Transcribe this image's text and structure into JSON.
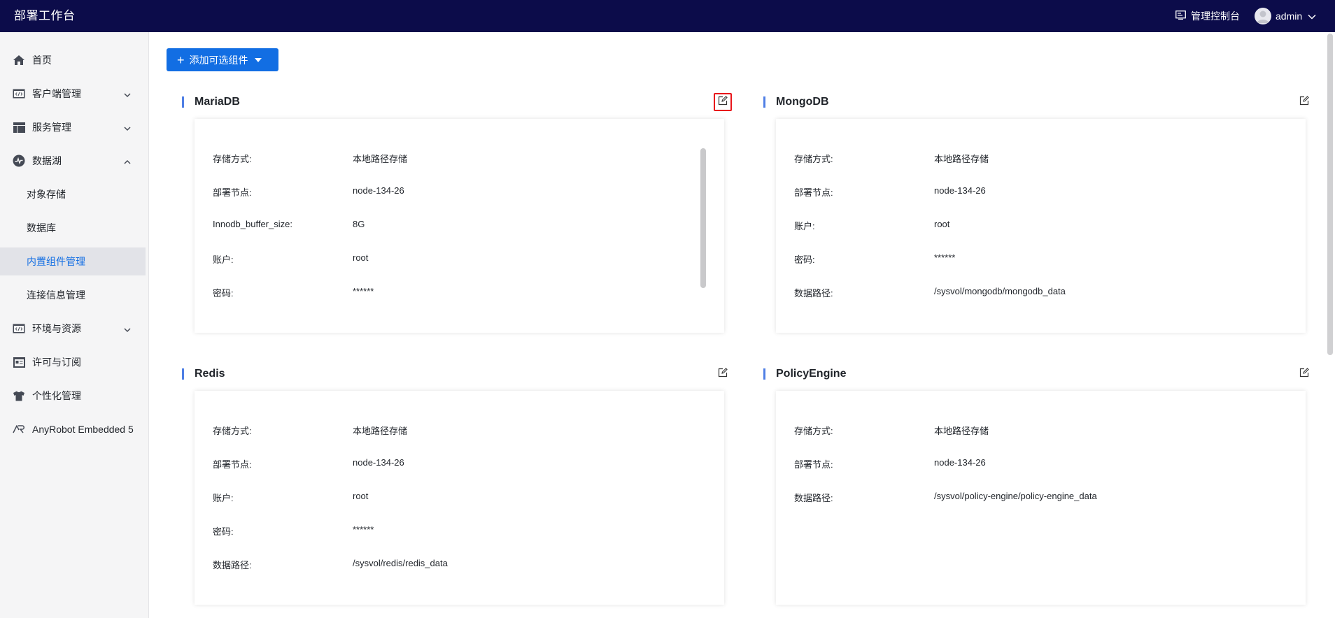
{
  "app": {
    "title": "部署工作台"
  },
  "topbar": {
    "console_label": "管理控制台",
    "user_name": "admin",
    "console_icon": "monitor-icon",
    "user_icon": "user-avatar-icon"
  },
  "sidebar": {
    "items": [
      {
        "label": "首页",
        "icon": "home-icon"
      },
      {
        "label": "客户端管理",
        "icon": "code-window-icon",
        "expandable": true,
        "expanded": false
      },
      {
        "label": "服务管理",
        "icon": "layout-icon",
        "expandable": true,
        "expanded": false
      },
      {
        "label": "数据湖",
        "icon": "pulse-icon",
        "expandable": true,
        "expanded": true
      },
      {
        "label": "环境与资源",
        "icon": "code-window-icon",
        "expandable": true,
        "expanded": false
      },
      {
        "label": "许可与订阅",
        "icon": "license-icon"
      },
      {
        "label": "个性化管理",
        "icon": "shirt-icon"
      },
      {
        "label": "AnyRobot Embedded 5",
        "icon": "anyrobot-icon"
      }
    ],
    "subitems": [
      {
        "label": "对象存储",
        "active": false
      },
      {
        "label": "数据库",
        "active": false
      },
      {
        "label": "内置组件管理",
        "active": true
      },
      {
        "label": "连接信息管理",
        "active": false
      }
    ]
  },
  "toolbar": {
    "add_label": "添加可选组件"
  },
  "components": [
    {
      "title": "MariaDB",
      "highlighted": true,
      "rows": [
        {
          "key": "存储方式:",
          "value": "本地路径存储"
        },
        {
          "key": "部署节点:",
          "value": "node-134-26"
        },
        {
          "key": "Innodb_buffer_size:",
          "value": "8G"
        },
        {
          "key": "账户:",
          "value": "root"
        },
        {
          "key": "密码:",
          "value": "******"
        }
      ]
    },
    {
      "title": "MongoDB",
      "highlighted": false,
      "rows": [
        {
          "key": "存储方式:",
          "value": "本地路径存储"
        },
        {
          "key": "部署节点:",
          "value": "node-134-26"
        },
        {
          "key": "账户:",
          "value": "root"
        },
        {
          "key": "密码:",
          "value": "******"
        },
        {
          "key": "数据路径:",
          "value": "/sysvol/mongodb/mongodb_data"
        }
      ]
    },
    {
      "title": "Redis",
      "highlighted": false,
      "rows": [
        {
          "key": "存储方式:",
          "value": "本地路径存储"
        },
        {
          "key": "部署节点:",
          "value": "node-134-26"
        },
        {
          "key": "账户:",
          "value": "root"
        },
        {
          "key": "密码:",
          "value": "******"
        },
        {
          "key": "数据路径:",
          "value": "/sysvol/redis/redis_data"
        }
      ]
    },
    {
      "title": "PolicyEngine",
      "highlighted": false,
      "rows": [
        {
          "key": "存储方式:",
          "value": "本地路径存储"
        },
        {
          "key": "部署节点:",
          "value": "node-134-26"
        },
        {
          "key": "数据路径:",
          "value": "/sysvol/policy-engine/policy-engine_data"
        }
      ]
    }
  ],
  "colors": {
    "topbar": "#0c0c4a",
    "primary": "#126ee3",
    "accent_bar": "#4f7fe5",
    "highlight": "#e8141a"
  }
}
